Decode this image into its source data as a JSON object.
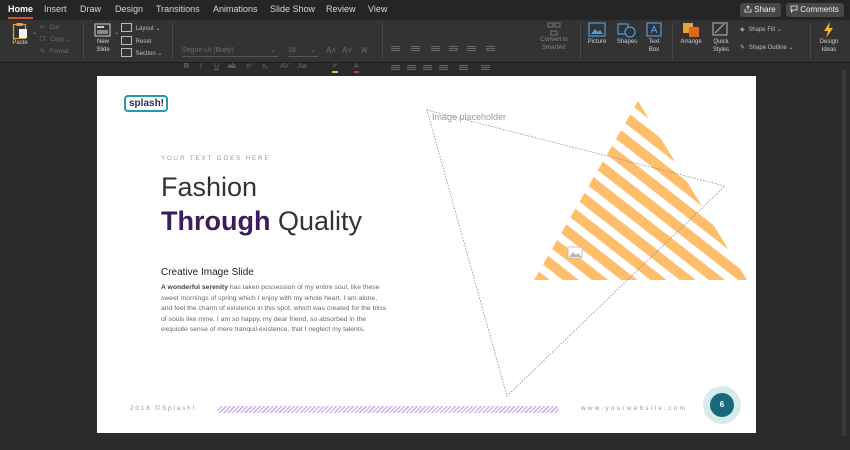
{
  "tabs": [
    "Home",
    "Insert",
    "Draw",
    "Design",
    "Transitions",
    "Animations",
    "Slide Show",
    "Review",
    "View"
  ],
  "active_tab": "Home",
  "share_label": "Share",
  "comments_label": "Comments",
  "ribbon": {
    "paste": "Paste",
    "cut": "Cut",
    "copy": "Copy",
    "format": "Format",
    "new_slide_line1": "New",
    "new_slide_line2": "Slide",
    "layout": "Layout",
    "reset": "Reset",
    "section": "Section",
    "font_name": "Segoe UI (Body)",
    "font_size": "18",
    "convert_line1": "Convert to",
    "convert_line2": "SmartArt",
    "picture": "Picture",
    "shapes": "Shapes",
    "text_box_line1": "Text",
    "text_box_line2": "Box",
    "arrange": "Arrange",
    "quick_styles_line1": "Quick",
    "quick_styles_line2": "Styles",
    "shape_fill": "Shape Fill",
    "shape_outline": "Shape Outline",
    "design_ideas_line1": "Design",
    "design_ideas_line2": "Ideas"
  },
  "slide": {
    "logo": "splash!",
    "eyebrow": "YOUR TEXT GOES HERE",
    "headline1": "Fashion",
    "headline2_bold": "Through",
    "headline2_rest": " Quality",
    "subhead": "Creative Image Slide",
    "para_bold": "A wonderful serenity",
    "para_rest": " has taken possession of my entire soul, like these sweet mornings of spring which I enjoy with my whole heart. I am alone, and feel the charm of existence in this spot, which was created for the bliss of souls like mine. I am so happy, my dear friend, so absorbed in the exquisite sense of mere tranquil existence, that I neglect my talents.",
    "placeholder_label": "Image placeholder",
    "footer_left": "2018 ©Splash!",
    "footer_right": "www.yourwebsite.com",
    "page_number": "6"
  },
  "colors": {
    "accent_tab": "#d35230",
    "headline_accent": "#3b1c5c",
    "triangle_stripes": "#ffbe6b",
    "page_badge": "#176a7c",
    "footer_stripe": "#cdb6ef"
  }
}
